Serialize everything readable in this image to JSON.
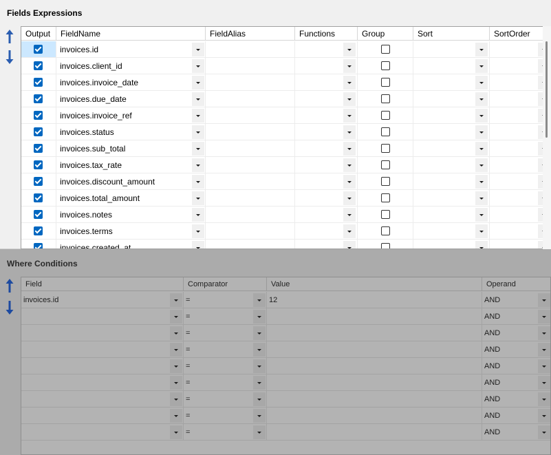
{
  "fields_panel": {
    "title": "Fields Expressions",
    "columns": [
      "Output",
      "FieldName",
      "FieldAlias",
      "Functions",
      "Group",
      "Sort",
      "SortOrder"
    ],
    "rows": [
      {
        "output": true,
        "field": "invoices.id",
        "group": false
      },
      {
        "output": true,
        "field": "invoices.client_id",
        "group": false
      },
      {
        "output": true,
        "field": "invoices.invoice_date",
        "group": false
      },
      {
        "output": true,
        "field": "invoices.due_date",
        "group": false
      },
      {
        "output": true,
        "field": "invoices.invoice_ref",
        "group": false
      },
      {
        "output": true,
        "field": "invoices.status",
        "group": false
      },
      {
        "output": true,
        "field": "invoices.sub_total",
        "group": false
      },
      {
        "output": true,
        "field": "invoices.tax_rate",
        "group": false
      },
      {
        "output": true,
        "field": "invoices.discount_amount",
        "group": false
      },
      {
        "output": true,
        "field": "invoices.total_amount",
        "group": false
      },
      {
        "output": true,
        "field": "invoices.notes",
        "group": false
      },
      {
        "output": true,
        "field": "invoices.terms",
        "group": false
      },
      {
        "output": true,
        "field": "invoices.created_at",
        "group": false
      }
    ]
  },
  "where_panel": {
    "title": "Where Conditions",
    "columns": [
      "Field",
      "Comparator",
      "Value",
      "Operand"
    ],
    "rows": [
      {
        "field": "invoices.id",
        "comparator": "=",
        "value": "12",
        "operand": "AND"
      },
      {
        "field": "",
        "comparator": "=",
        "value": "",
        "operand": "AND"
      },
      {
        "field": "",
        "comparator": "=",
        "value": "",
        "operand": "AND"
      },
      {
        "field": "",
        "comparator": "=",
        "value": "",
        "operand": "AND"
      },
      {
        "field": "",
        "comparator": "=",
        "value": "",
        "operand": "AND"
      },
      {
        "field": "",
        "comparator": "=",
        "value": "",
        "operand": "AND"
      },
      {
        "field": "",
        "comparator": "=",
        "value": "",
        "operand": "AND"
      },
      {
        "field": "",
        "comparator": "=",
        "value": "",
        "operand": "AND"
      },
      {
        "field": "",
        "comparator": "=",
        "value": "",
        "operand": "AND"
      }
    ]
  },
  "icons": {
    "move_up": "arrow-up-icon",
    "move_down": "arrow-down-icon",
    "dropdown": "chevron-down-icon"
  },
  "colors": {
    "accent": "#0067c0",
    "arrow": "#2a5db0",
    "selection": "#cce8ff"
  }
}
